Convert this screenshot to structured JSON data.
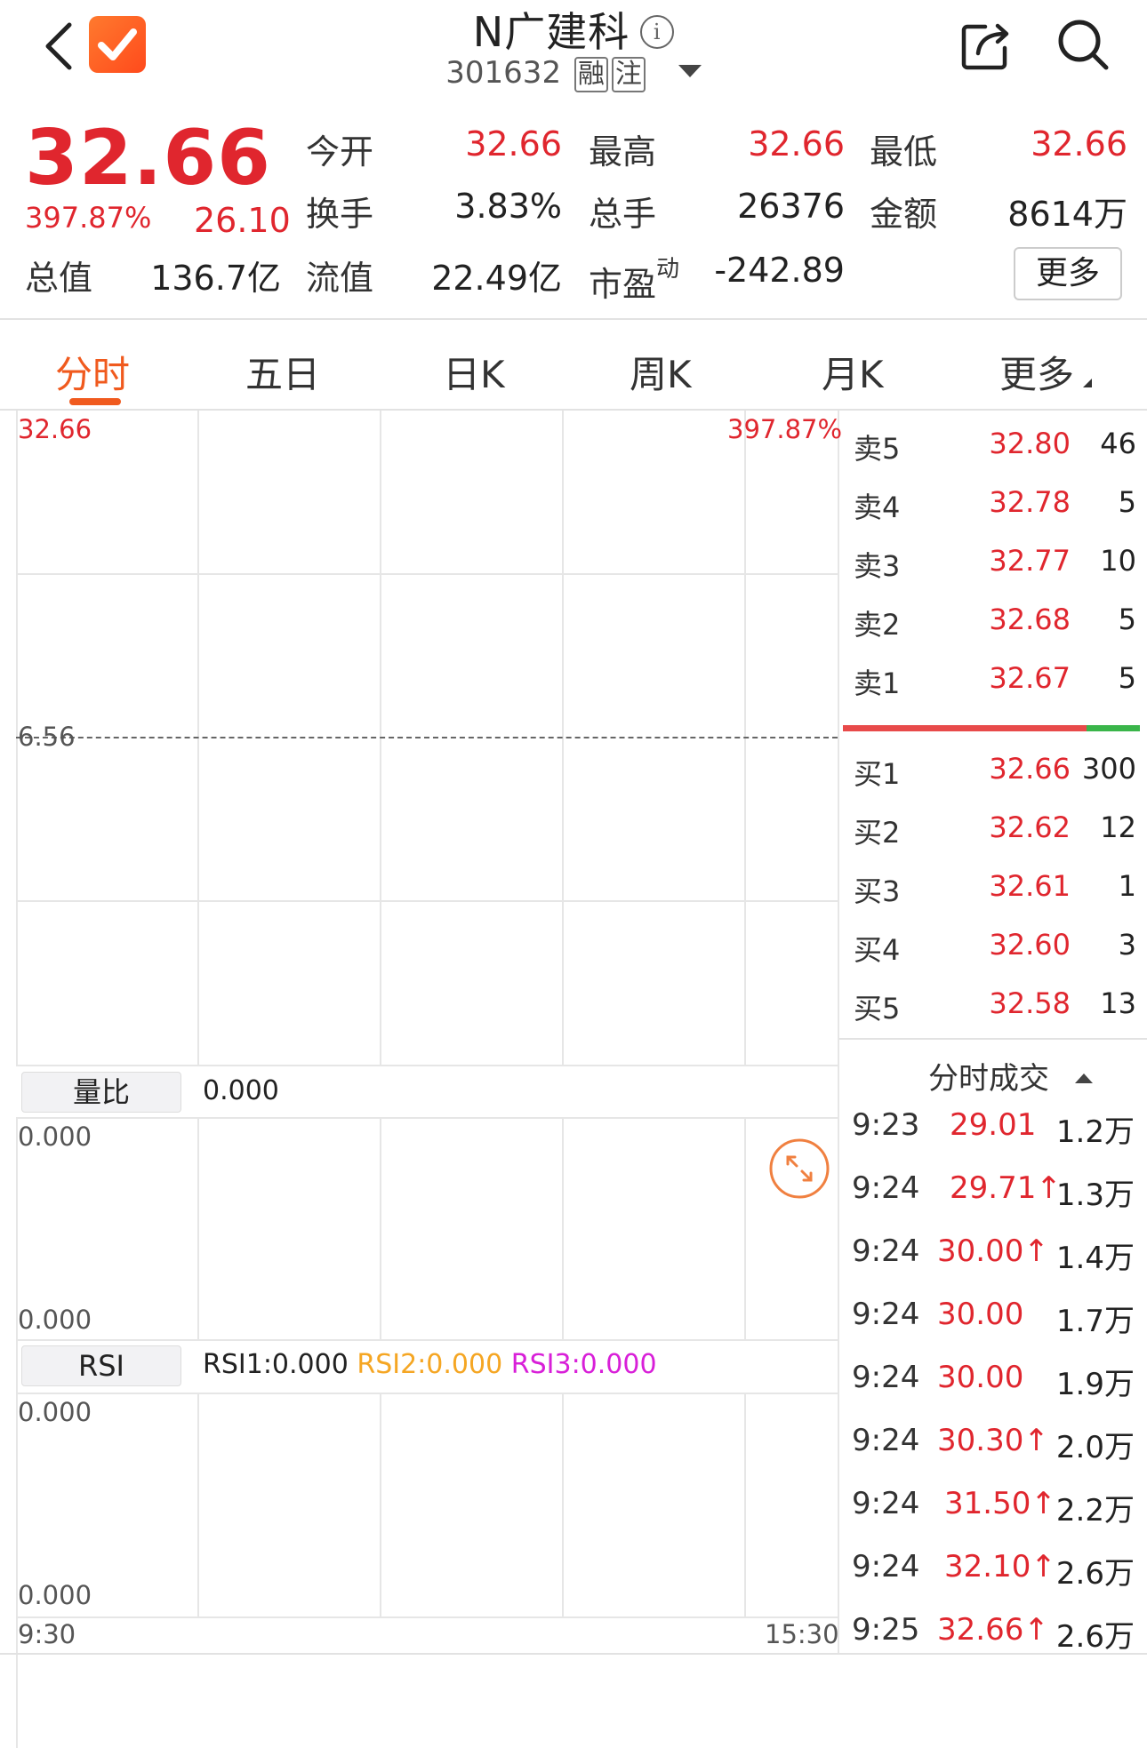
{
  "header": {
    "title": "N广建科",
    "code": "301632",
    "tag1": "融",
    "tag2": "注",
    "info_icon": "info-icon",
    "share_icon": "share-icon",
    "search_icon": "search-icon",
    "back_icon": "back-chevron-icon"
  },
  "quote": {
    "price": "32.66",
    "change_pct": "397.87%",
    "change_abs": "26.10",
    "open_label": "今开",
    "open_value": "32.66",
    "high_label": "最高",
    "high_value": "32.66",
    "low_label": "最低",
    "low_value": "32.66",
    "turnover_label": "换手",
    "turnover_value": "3.83%",
    "volume_label": "总手",
    "volume_value": "26376",
    "amount_label": "金额",
    "amount_value": "8614万",
    "mktcap_label": "总值",
    "mktcap_value": "136.7亿",
    "float_label": "流值",
    "float_value": "22.49亿",
    "pe_label": "市盈",
    "pe_sup": "动",
    "pe_value": "-242.89",
    "more_button": "更多"
  },
  "tabs": [
    {
      "label": "分时",
      "active": true
    },
    {
      "label": "五日"
    },
    {
      "label": "日K"
    },
    {
      "label": "周K"
    },
    {
      "label": "月K"
    },
    {
      "label": "更多"
    }
  ],
  "chart": {
    "price_top": "32.66",
    "pct_top": "397.87%",
    "prev_close": "6.56",
    "volratio_button": "量比",
    "volratio_value": "0.000",
    "vol_top": "0.000",
    "vol_bottom": "0.000",
    "rsi_button": "RSI",
    "rsi1": "RSI1:0.000",
    "rsi2": "RSI2:0.000",
    "rsi3": "RSI3:0.000",
    "rsi_top": "0.000",
    "rsi_bottom": "0.000",
    "time_start": "9:30",
    "time_end": "15:30",
    "expand_icon": "expand-arrows-icon",
    "colors": {
      "up": "#e0262e",
      "accent": "#f05a1e",
      "rsi2": "#f5a623",
      "rsi3": "#d81fd8"
    }
  },
  "orderbook": {
    "asks": [
      {
        "label": "卖5",
        "price": "32.80",
        "vol": "46"
      },
      {
        "label": "卖4",
        "price": "32.78",
        "vol": "5"
      },
      {
        "label": "卖3",
        "price": "32.77",
        "vol": "10"
      },
      {
        "label": "卖2",
        "price": "32.68",
        "vol": "5"
      },
      {
        "label": "卖1",
        "price": "32.67",
        "vol": "5"
      }
    ],
    "bids": [
      {
        "label": "买1",
        "price": "32.66",
        "vol": "300"
      },
      {
        "label": "买2",
        "price": "32.62",
        "vol": "12"
      },
      {
        "label": "买3",
        "price": "32.61",
        "vol": "1"
      },
      {
        "label": "买4",
        "price": "32.60",
        "vol": "3"
      },
      {
        "label": "买5",
        "price": "32.58",
        "vol": "13"
      }
    ],
    "bid_ratio": 0.82
  },
  "trades": {
    "header": "分时成交",
    "rows": [
      {
        "time": "9:23",
        "price": "29.01",
        "vol": "1.2万"
      },
      {
        "time": "9:24",
        "price": "29.71↑",
        "vol": "1.3万"
      },
      {
        "time": "9:24",
        "price": "30.00↑",
        "vol": "1.4万"
      },
      {
        "time": "9:24",
        "price": "30.00",
        "vol": "1.7万"
      },
      {
        "time": "9:24",
        "price": "30.00",
        "vol": "1.9万"
      },
      {
        "time": "9:24",
        "price": "30.30↑",
        "vol": "2.0万"
      },
      {
        "time": "9:24",
        "price": "31.50↑",
        "vol": "2.2万"
      },
      {
        "time": "9:24",
        "price": "32.10↑",
        "vol": "2.6万"
      },
      {
        "time": "9:25",
        "price": "32.66↑",
        "vol": "2.6万"
      }
    ]
  }
}
